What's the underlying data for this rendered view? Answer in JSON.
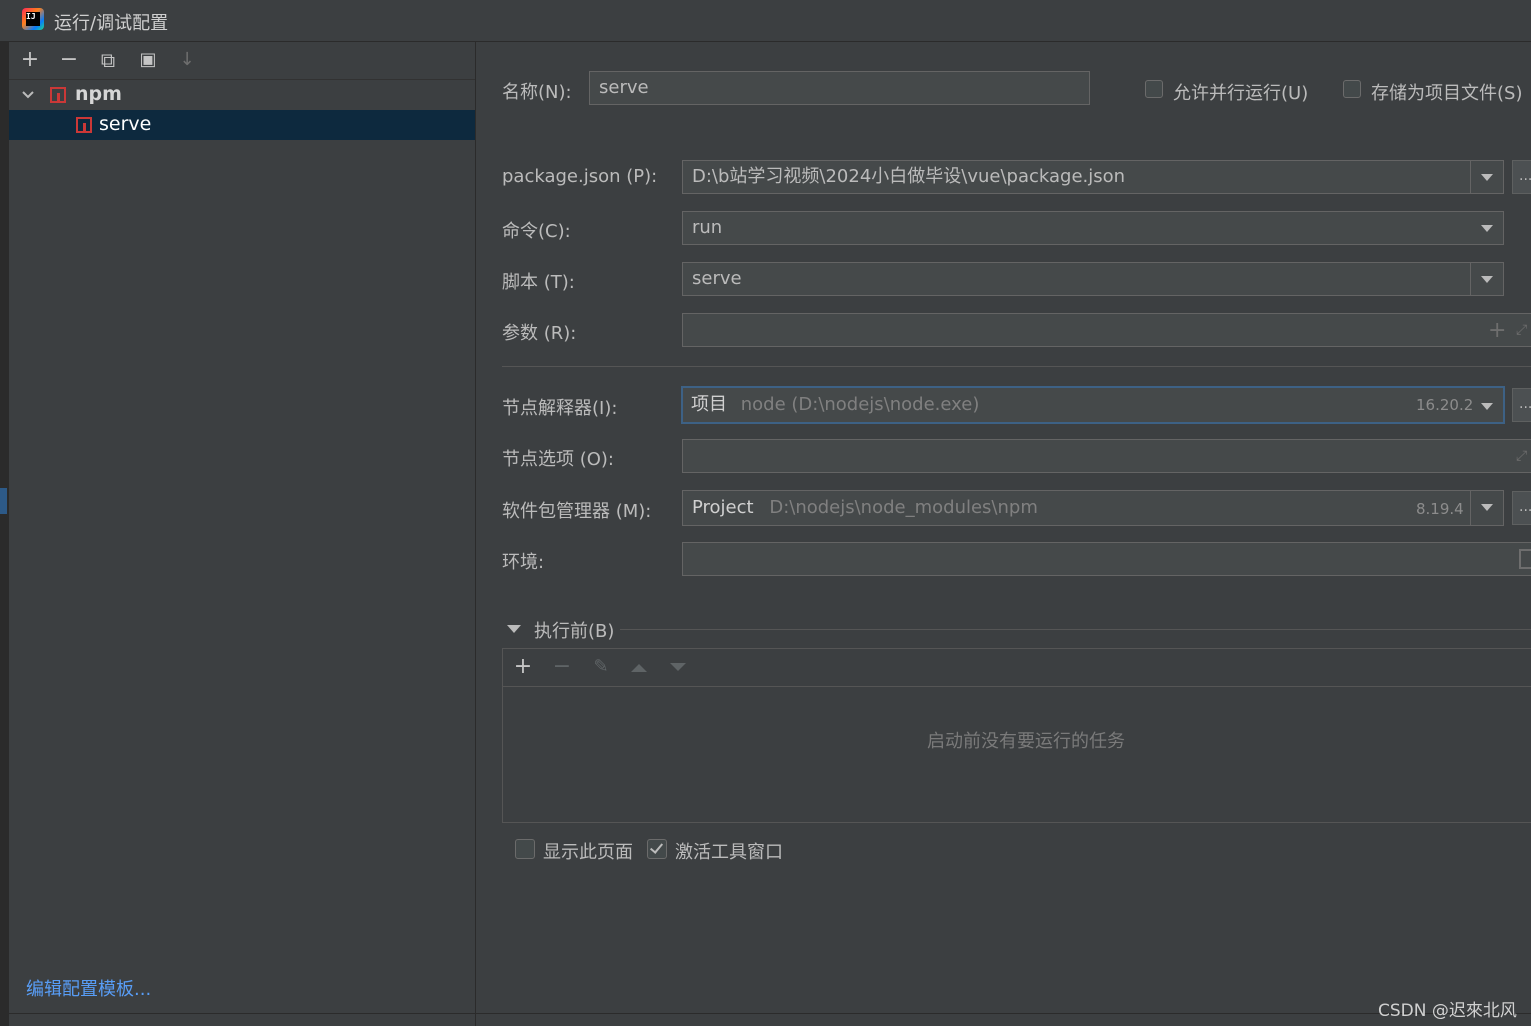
{
  "window": {
    "title": "运行/调试配置"
  },
  "toolbar": {
    "add": "+",
    "remove": "−",
    "copy": "⧉",
    "folder": "▣",
    "sort": "↓"
  },
  "tree": {
    "group": {
      "label": "npm",
      "expanded": true
    },
    "items": [
      {
        "label": "serve",
        "selected": true
      }
    ]
  },
  "edit_templates_link": "编辑配置模板...",
  "form": {
    "name_label": "名称(N):",
    "name_value": "serve",
    "allow_parallel_label": "允许并行运行(U)",
    "allow_parallel_checked": false,
    "store_as_file_label": "存储为项目文件(S)",
    "store_as_file_checked": false,
    "package_json_label": "package.json (P):",
    "package_json_value": "D:\\b站学习视频\\2024小白做毕设\\vue\\package.json",
    "command_label": "命令(C):",
    "command_value": "run",
    "script_label": "脚本 (T):",
    "script_value": "serve",
    "args_label": "参数 (R):",
    "args_value": "",
    "node_interpreter_label": "节点解释器(I):",
    "node_interpreter_prefix": "项目",
    "node_interpreter_path": "node (D:\\nodejs\\node.exe)",
    "node_version": "16.20.2",
    "node_options_label": "节点选项 (O):",
    "node_options_value": "",
    "package_manager_label": "软件包管理器 (M):",
    "package_manager_prefix": "Project",
    "package_manager_path": "D:\\nodejs\\node_modules\\npm",
    "package_manager_version": "8.19.4",
    "env_label": "环境:",
    "env_value": "",
    "browse_label": "..."
  },
  "before_launch": {
    "title": "执行前(B)",
    "empty_text": "启动前没有要运行的任务"
  },
  "show_page_label": "显示此页面",
  "show_page_checked": false,
  "activate_tool_window_label": "激活工具窗口",
  "activate_tool_window_checked": true,
  "watermark": "CSDN @迟來北风"
}
